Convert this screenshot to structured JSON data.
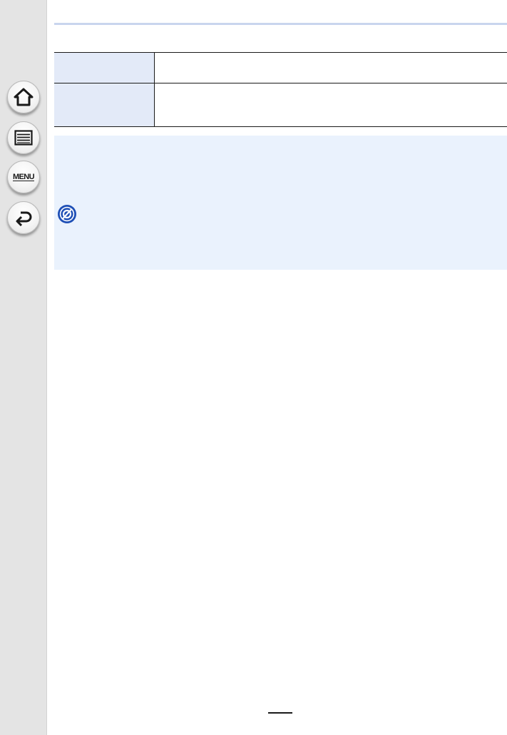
{
  "sidebar": {
    "home_icon": "home-icon",
    "list_icon": "list-icon",
    "menu_label": "MENU",
    "back_icon": "back-arrow-icon"
  },
  "table": {
    "rows": [
      {
        "label": "",
        "value": ""
      },
      {
        "label": "",
        "value": ""
      }
    ]
  },
  "note": {
    "icon": "not-available-icon",
    "text": ""
  },
  "colors": {
    "sidebar_bg": "#e4e4e4",
    "header_rule": "#c9d5ee",
    "table_label_bg": "#e3eaf8",
    "note_bg": "#eaf2fd",
    "note_icon": "#1e4fb6"
  }
}
